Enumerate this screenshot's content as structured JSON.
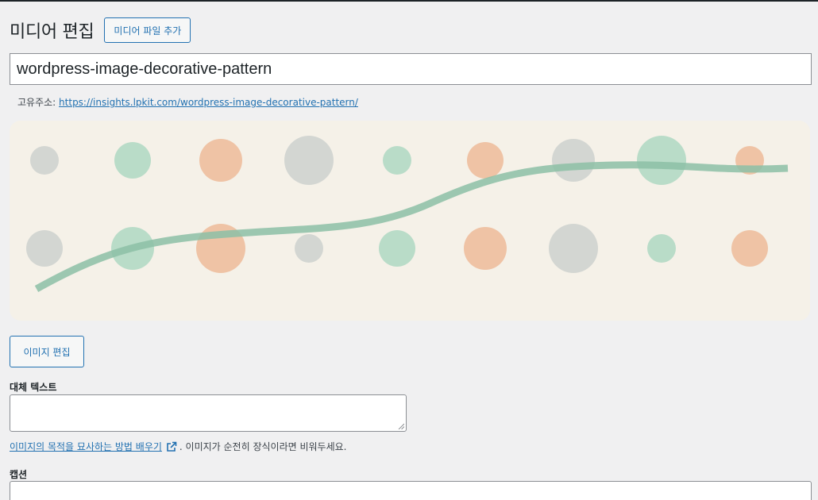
{
  "header": {
    "title": "미디어 편집",
    "add_button_label": "미디어 파일 추가"
  },
  "title_field": {
    "value": "wordpress-image-decorative-pattern"
  },
  "permalink": {
    "label": "고유주소:",
    "url": "https://insights.lpkit.com/wordpress-image-decorative-pattern/"
  },
  "image": {
    "background": "#f5f1e8",
    "line_color": "#8cbfa6",
    "dot_colors": {
      "grey": "#d3d6d2",
      "green": "#b9dcc8",
      "orange": "#efc3a5"
    }
  },
  "edit_image_button_label": "이미지 편집",
  "alt_text": {
    "label": "대체 텍스트",
    "value": "",
    "help_link": "이미지의 목적을 묘사하는 방법 배우기",
    "help_text": ". 이미지가 순전히 장식이라면 비워두세요."
  },
  "caption": {
    "label": "캡션",
    "value": ""
  },
  "icons": {
    "external_link": "external-link-icon",
    "resize": "resize-grip-icon"
  },
  "colors": {
    "accent": "#2271b1",
    "page_bg": "#f0f0f1"
  }
}
